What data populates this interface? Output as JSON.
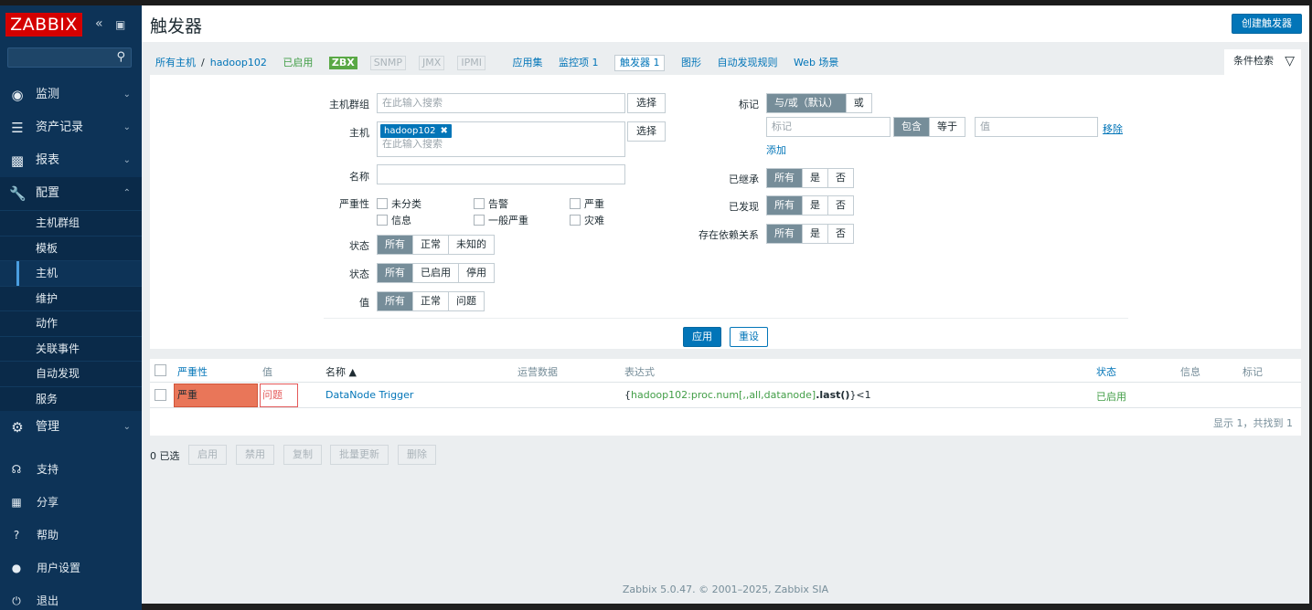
{
  "sidebar": {
    "logo": "ZABBIX",
    "menu": [
      {
        "label": "监测",
        "icon": "eye-icon"
      },
      {
        "label": "资产记录",
        "icon": "list-icon"
      },
      {
        "label": "报表",
        "icon": "bar-chart-icon"
      },
      {
        "label": "配置",
        "icon": "wrench-icon"
      }
    ],
    "config_sub": [
      "主机群组",
      "模板",
      "主机",
      "维护",
      "动作",
      "关联事件",
      "自动发现",
      "服务"
    ],
    "admin": {
      "label": "管理",
      "icon": "gear-icon"
    },
    "bottom": [
      {
        "label": "支持",
        "icon": "headset-icon"
      },
      {
        "label": "分享",
        "icon": "share-icon"
      },
      {
        "label": "帮助",
        "icon": "help-icon"
      },
      {
        "label": "用户设置",
        "icon": "user-icon"
      },
      {
        "label": "退出",
        "icon": "power-icon"
      }
    ]
  },
  "header": {
    "title": "触发器",
    "create_button": "创建触发器"
  },
  "nav": {
    "all_hosts": "所有主机",
    "separator": "/",
    "host": "hadoop102",
    "enabled": "已启用",
    "zbx": "ZBX",
    "snmp": "SNMP",
    "jmx": "JMX",
    "ipmi": "IPMI",
    "applications": "应用集",
    "items": "监控项 1",
    "triggers": "触发器 1",
    "graphs": "图形",
    "discovery": "自动发现规则",
    "web": "Web 场景"
  },
  "filter_tab": "条件检索",
  "filter": {
    "host_group_label": "主机群组",
    "host_group_placeholder": "在此输入搜索",
    "select": "选择",
    "host_label": "主机",
    "host_chip": "hadoop102",
    "host_placeholder": "在此输入搜索",
    "name_label": "名称",
    "severity_label": "严重性",
    "severities": [
      "未分类",
      "告警",
      "严重",
      "信息",
      "一般严重",
      "灾难"
    ],
    "state_label": "状态",
    "state_opts": [
      "所有",
      "正常",
      "未知的"
    ],
    "status_label": "状态",
    "status_opts": [
      "所有",
      "已启用",
      "停用"
    ],
    "value_label": "值",
    "value_opts": [
      "所有",
      "正常",
      "问题"
    ],
    "tags_label": "标记",
    "tags_opts": [
      "与/或（默认）",
      "或"
    ],
    "tag_placeholder": "标记",
    "tag_ops": [
      "包含",
      "等于"
    ],
    "tag_value_placeholder": "值",
    "remove": "移除",
    "add": "添加",
    "inherited_label": "已继承",
    "discovered_label": "已发现",
    "depends_label": "存在依赖关系",
    "yn_opts": [
      "所有",
      "是",
      "否"
    ],
    "apply": "应用",
    "reset": "重设"
  },
  "table": {
    "headers": {
      "severity": "严重性",
      "value": "值",
      "name": "名称 ▲",
      "operational": "运营数据",
      "expression": "表达式",
      "status": "状态",
      "info": "信息",
      "tags": "标记"
    },
    "row": {
      "severity": "严重",
      "value": "问题",
      "name": "DataNode Trigger",
      "expr_open": "{",
      "expr_host": "hadoop102:proc.num[,,all,datanode]",
      "expr_fn": ".last()",
      "expr_close": "}<1",
      "status": "已启用"
    },
    "paging": "显示 1，共找到 1"
  },
  "actions": {
    "selected": "0 已选",
    "buttons": [
      "启用",
      "禁用",
      "复制",
      "批量更新",
      "删除"
    ]
  },
  "footer": "Zabbix 5.0.47. © 2001–2025, Zabbix SIA"
}
